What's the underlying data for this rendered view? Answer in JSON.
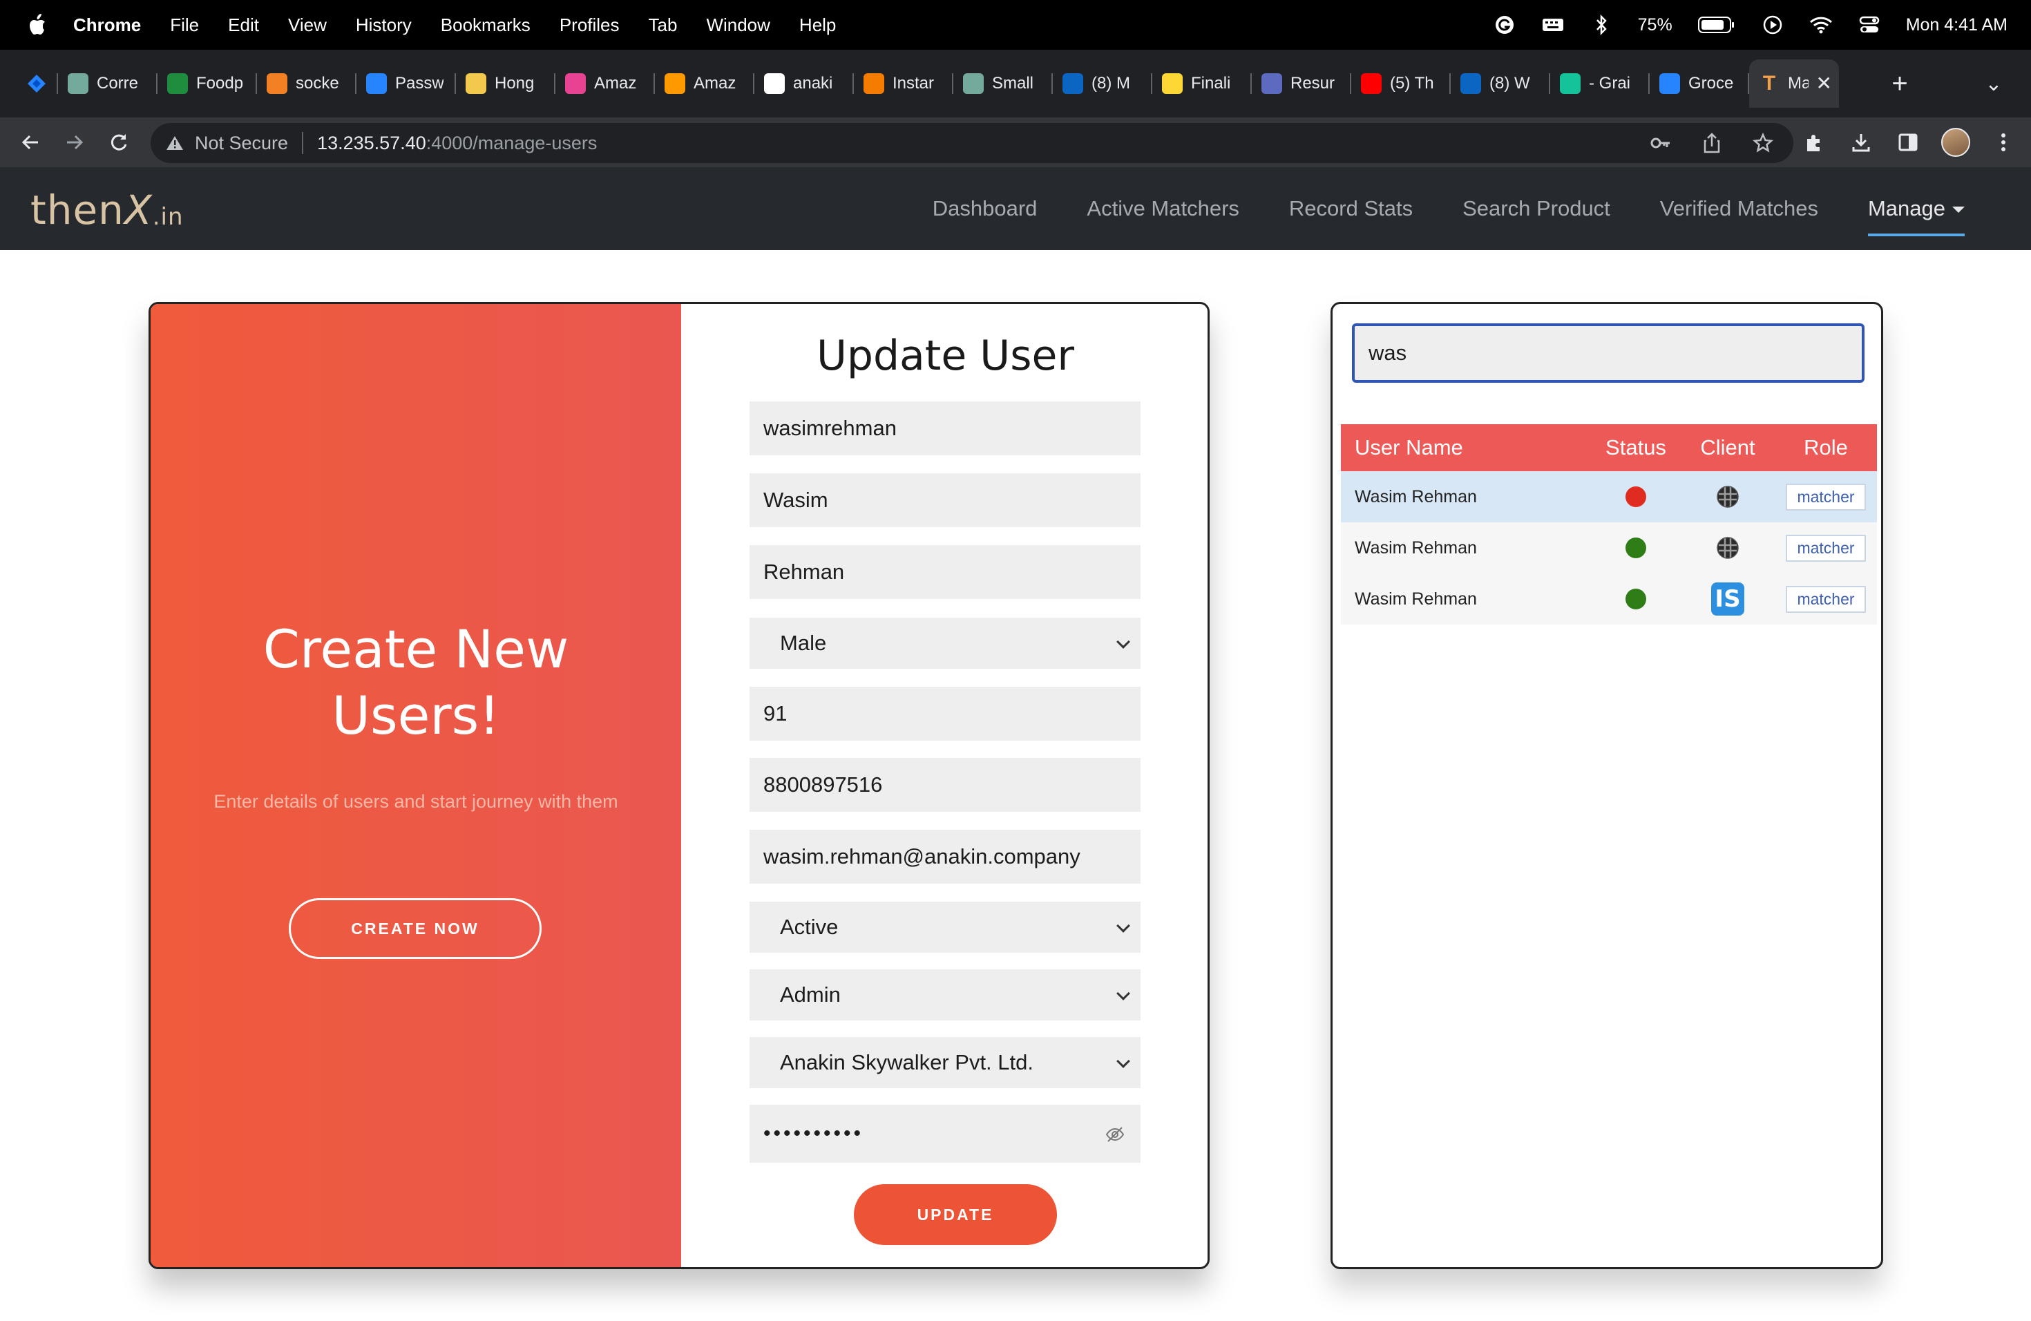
{
  "menubar": {
    "app": "Chrome",
    "items": [
      "File",
      "Edit",
      "View",
      "History",
      "Bookmarks",
      "Profiles",
      "Tab",
      "Window",
      "Help"
    ],
    "battery": "75%",
    "clock": "Mon 4:41 AM"
  },
  "tabs": [
    {
      "label": "Corre",
      "icon": "chatgpt-icon",
      "color": "#74aa9c"
    },
    {
      "label": "Foodp",
      "icon": "sheets-icon",
      "color": "#1e8e3e"
    },
    {
      "label": "socke",
      "icon": "stackoverflow-icon",
      "color": "#f48024"
    },
    {
      "label": "Passw",
      "icon": "confluence-icon",
      "color": "#2684ff"
    },
    {
      "label": "Hong",
      "icon": "hong-icon",
      "color": "#f2c94c"
    },
    {
      "label": "Amaz",
      "icon": "calendar-icon",
      "color": "#e84393"
    },
    {
      "label": "Amaz",
      "icon": "aws-icon",
      "color": "#ff9900"
    },
    {
      "label": "anaki",
      "icon": "github-icon",
      "color": "#ffffff"
    },
    {
      "label": "Instar",
      "icon": "instar-icon",
      "color": "#f57c00"
    },
    {
      "label": "Small",
      "icon": "chatgpt-icon",
      "color": "#74aa9c"
    },
    {
      "label": "(8) M",
      "icon": "linkedin-icon",
      "color": "#0a66c2"
    },
    {
      "label": "Finali",
      "icon": "finalize-icon",
      "color": "#fdd835"
    },
    {
      "label": "Resur",
      "icon": "resume-icon",
      "color": "#5c6bc0"
    },
    {
      "label": "(5) Th",
      "icon": "youtube-icon",
      "color": "#ff0000"
    },
    {
      "label": "(8) W",
      "icon": "linkedin-icon",
      "color": "#0a66c2"
    },
    {
      "label": "- Grai",
      "icon": "grammarly-icon",
      "color": "#15c39a"
    },
    {
      "label": "Groce",
      "icon": "confluence-icon",
      "color": "#2684ff"
    }
  ],
  "active_tab": {
    "label": "Ma",
    "icon": "thenx-icon",
    "color": "#f0a04b"
  },
  "omnibox": {
    "security": "Not Secure",
    "host": "13.235.57.40",
    "path": ":4000/manage-users"
  },
  "nav": {
    "logo_main": "then",
    "logo_x": "X",
    "logo_suffix": ".in",
    "links": [
      "Dashboard",
      "Active Matchers",
      "Record Stats",
      "Search Product",
      "Verified Matches"
    ],
    "manage": "Manage"
  },
  "create_panel": {
    "title_line1": "Create New",
    "title_line2": "Users!",
    "subtitle": "Enter details of users and start journey with them",
    "button": "CREATE NOW"
  },
  "form": {
    "title": "Update User",
    "username": "wasimrehman",
    "first_name": "Wasim",
    "last_name": "Rehman",
    "gender": "Male",
    "country_code": "91",
    "phone": "8800897516",
    "email": "wasim.rehman@anakin.company",
    "status": "Active",
    "role": "Admin",
    "company": "Anakin Skywalker Pvt. Ltd.",
    "password_mask": "••••••••••",
    "submit": "UPDATE"
  },
  "search": {
    "value": "was"
  },
  "table": {
    "headers": [
      "User Name",
      "Status",
      "Client",
      "Role"
    ],
    "rows": [
      {
        "name": "Wasim Rehman",
        "status": "inactive",
        "status_color": "#e02b20",
        "client": "client-globe-icon",
        "role": "matcher"
      },
      {
        "name": "Wasim Rehman",
        "status": "active",
        "status_color": "#2e7d17",
        "client": "client-globe-icon",
        "role": "matcher"
      },
      {
        "name": "Wasim Rehman",
        "status": "active",
        "status_color": "#2e7d17",
        "client": "client-is-icon",
        "client_text": "IS",
        "role": "matcher"
      }
    ]
  }
}
